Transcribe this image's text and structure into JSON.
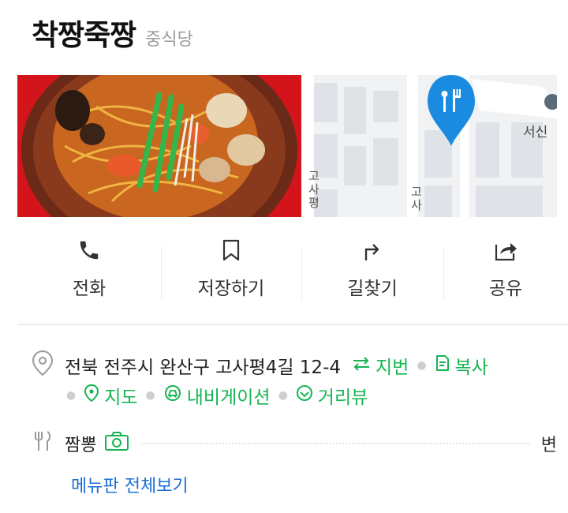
{
  "place": {
    "name": "착짱죽짱",
    "category": "중식당"
  },
  "map": {
    "labels": [
      "서신",
      "고사평",
      "고사"
    ]
  },
  "actions": [
    {
      "label": "전화",
      "icon": "phone-icon"
    },
    {
      "label": "저장하기",
      "icon": "bookmark-icon"
    },
    {
      "label": "길찾기",
      "icon": "directions-icon"
    },
    {
      "label": "공유",
      "icon": "share-icon"
    }
  ],
  "address": {
    "text": "전북 전주시 완산구 고사평4길 12-4",
    "jibun": "지번",
    "copy": "복사",
    "map": "지도",
    "navigation": "내비게이션",
    "streetview": "거리뷰"
  },
  "menu": {
    "item": "짬뽕",
    "price": "변",
    "view_all": "메뉴판 전체보기"
  },
  "colors": {
    "accent_green": "#16b552",
    "link_blue": "#1a6fd6",
    "pin_blue": "#1a8be0"
  }
}
